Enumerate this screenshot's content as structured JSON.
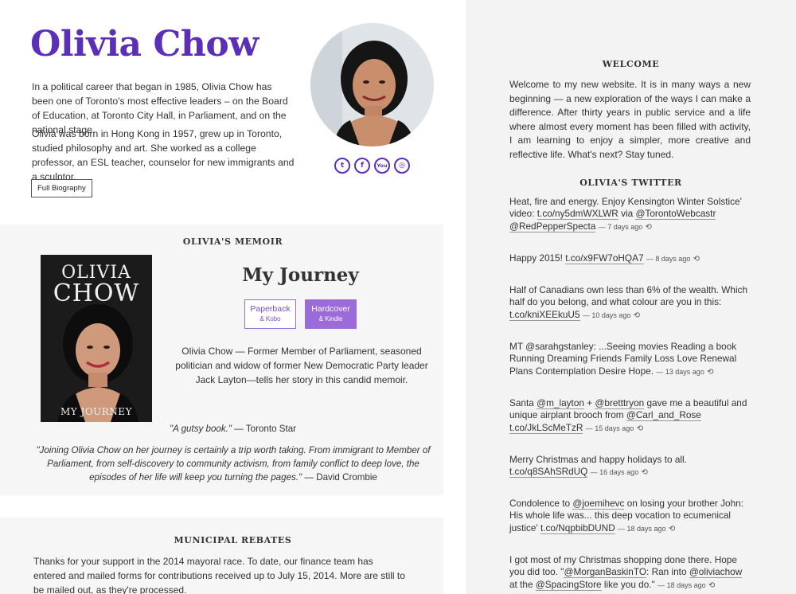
{
  "hero": {
    "name": "Olivia Chow",
    "bio_p1": "In a political career that began in 1985, Olivia Chow has been one of Toronto's most effective leaders – on the Board of Education, at Toronto City Hall, in Parliament, and on the national stage.",
    "bio_p2": "Olivia was born in Hong Kong in 1957, grew up in Toronto, studied philosophy and art. She worked as a college professor, an ESL teacher, counselor for new immigrants and a sculptor.",
    "bio_button": "Full Biography",
    "social": [
      {
        "icon": "twitter-icon",
        "glyph": "t"
      },
      {
        "icon": "facebook-icon",
        "glyph": "f"
      },
      {
        "icon": "youtube-icon",
        "glyph": "You"
      },
      {
        "icon": "instagram-icon",
        "glyph": "◎"
      }
    ]
  },
  "memoir": {
    "section_title": "OLIVIA'S MEMOIR",
    "book_cover_line1": "OLIVIA",
    "book_cover_line2": "CHOW",
    "book_cover_sub": "MY JOURNEY",
    "title": "My Journey",
    "paperback_label": "Paperback",
    "paperback_sub": "& Kobo",
    "hardcover_label": "Hardcover",
    "hardcover_sub": "& Kindle",
    "description": "Olivia Chow — Former Member of Parliament, seasoned politician and widow of former New Democratic Party leader Jack Layton—tells her story in this candid memoir.",
    "quote1_text": "\"A gutsy book.\"",
    "quote1_source": " — Toronto Star",
    "quote2_text": "\"Joining Olivia Chow on her journey is certainly a trip worth taking. From immigrant to Member of Parliament, from self-discovery to community activism, from family conflict to deep love, the episodes of her life will keep you turning the pages.\"",
    "quote2_source": " — David Crombie"
  },
  "rebates": {
    "section_title": "MUNICIPAL REBATES",
    "text": "Thanks for your support in the 2014 mayoral race. To date, our finance team has entered and mailed forms for contributions received up to July 15, 2014. More are still to be mailed out, as they're processed."
  },
  "welcome": {
    "section_title": "WELCOME",
    "text": "Welcome to my new website. It is in many ways a new beginning — a new exploration of the ways I can make a difference. After thirty years in public service and a life where almost every moment has been filled with activity, I am learning to enjoy a simpler, more creative and reflective life. What's next? Stay tuned."
  },
  "twitter": {
    "section_title": "OLIVIA'S TWITTER",
    "tweets": [
      {
        "pre": "Heat, fire and energy. Enjoy Kensington Winter Solstice' video: ",
        "link": "t.co/ny5dmWXLWR",
        "mid": " via ",
        "link2": "@TorontoWebcastr",
        "mid2": " ",
        "link3": "@RedPepperSpecta",
        "ago": "7 days ago"
      },
      {
        "pre": "Happy 2015! ",
        "link": "t.co/x9FW7oHQA7",
        "mid": "",
        "link2": "",
        "mid2": "",
        "link3": "",
        "ago": "8 days ago"
      },
      {
        "pre": "Half of Canadians own less than 6% of the wealth. Which half do you belong, and what colour are you in this: ",
        "link": "t.co/kniXEEkuU5",
        "mid": "",
        "link2": "",
        "mid2": "",
        "link3": "",
        "ago": "10 days ago"
      },
      {
        "pre": "MT @sarahgstanley: ...Seeing movies Reading a book Running Dreaming Friends Family Loss Love Renewal Plans Contemplation Desire Hope.",
        "link": "",
        "mid": "",
        "link2": "",
        "mid2": "",
        "link3": "",
        "ago": "13 days ago"
      },
      {
        "pre": "Santa ",
        "link": "@m_layton",
        "mid": " + ",
        "link2": "@bretttryon",
        "mid2": " gave me a beautiful and unique airplant brooch from ",
        "link3": "@Carl_and_Rose",
        "tail_link": "t.co/JkLScMeTzR",
        "ago": "15 days ago"
      },
      {
        "pre": "Merry Christmas and happy holidays to all. ",
        "link": "t.co/q8SAhSRdUQ",
        "mid": "",
        "link2": "",
        "mid2": "",
        "link3": "",
        "ago": "16 days ago"
      },
      {
        "pre": "Condolence to ",
        "link": "@joemihevc",
        "mid": " on losing your brother John: His whole life was... this deep vocation to ecumenical justice' ",
        "link2": "t.co/NqpbibDUND",
        "mid2": "",
        "link3": "",
        "ago": "18 days ago"
      },
      {
        "pre": "I got most of my Christmas shopping done there. Hope you did too. \"",
        "link": "@MorganBaskinTO",
        "mid": ": Ran into ",
        "link2": "@oliviachow",
        "mid2": " at the ",
        "link3": "@SpacingStore",
        "tail": " like you do.\"",
        "ago": "18 days ago"
      }
    ]
  },
  "colors": {
    "accent": "#5b2fb8",
    "button_purple": "#9b6bd9",
    "right_bg": "#f3f3f3",
    "section_bg": "#f6f6f6"
  }
}
